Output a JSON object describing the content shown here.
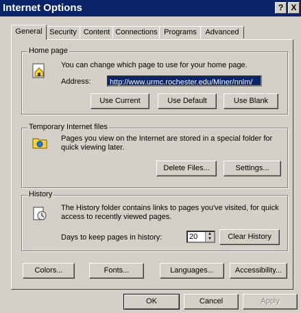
{
  "title": "Internet Options",
  "title_buttons": {
    "help": "?",
    "close": "X"
  },
  "tabs": [
    "General",
    "Security",
    "Content",
    "Connections",
    "Programs",
    "Advanced"
  ],
  "home": {
    "legend": "Home page",
    "desc": "You can change which page to use for your home page.",
    "address_label": "Address:",
    "address_value": "http://www.urmc.rochester.edu/Miner/nnlm/",
    "use_current": "Use Current",
    "use_default": "Use Default",
    "use_blank": "Use Blank"
  },
  "temp": {
    "legend": "Temporary Internet files",
    "desc": "Pages you view on the Internet are stored in a special folder for quick viewing later.",
    "delete_files": "Delete Files...",
    "settings": "Settings..."
  },
  "history": {
    "legend": "History",
    "desc": "The History folder contains links to pages you've visited, for quick access to recently viewed pages.",
    "days_label": "Days to keep pages in history:",
    "days_value": "20",
    "clear": "Clear History"
  },
  "bottom": {
    "colors": "Colors...",
    "fonts": "Fonts...",
    "languages": "Languages...",
    "accessibility": "Accessibility..."
  },
  "dialog": {
    "ok": "OK",
    "cancel": "Cancel",
    "apply": "Apply"
  }
}
